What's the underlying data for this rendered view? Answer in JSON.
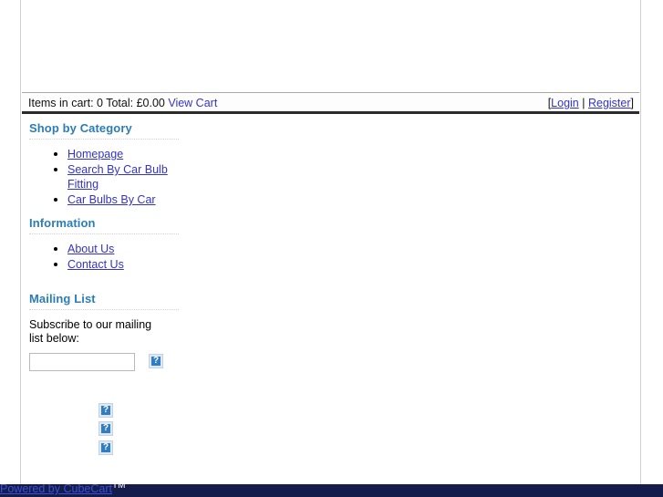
{
  "cart_bar": {
    "summary_text": "Items in cart: 0 Total: £0.00",
    "view_cart_label": "View Cart",
    "account_open_bracket": "[",
    "login_label": "Login",
    "account_separator": " | ",
    "register_label": "Register",
    "account_close_bracket": "]"
  },
  "sidebar": {
    "boxes": [
      {
        "title": "Shop by Category",
        "items": [
          {
            "label": "Homepage"
          },
          {
            "label": "Search By Car Bulb Fitting"
          },
          {
            "label": "Car Bulbs By Car"
          }
        ]
      },
      {
        "title": "Information",
        "items": [
          {
            "label": "About Us"
          },
          {
            "label": "Contact Us"
          }
        ]
      }
    ],
    "mailing_list": {
      "title": "Mailing List",
      "copy": "Subscribe to our mailing list below:",
      "input_value": "",
      "input_placeholder": "",
      "submit_icon": "broken-image-icon"
    },
    "stacked_icons": [
      {
        "icon": "broken-image-icon"
      },
      {
        "icon": "broken-image-icon"
      },
      {
        "icon": "broken-image-icon"
      }
    ]
  },
  "footer": {
    "powered_by_label": "Powered by CubeCart",
    "trademark": "TM"
  },
  "colors": {
    "heading_blue": "#2b7db5",
    "link_blue": "#3333cc",
    "footer_navy": "#141c4b",
    "cart_bar_rule": "#2b2b2b"
  }
}
